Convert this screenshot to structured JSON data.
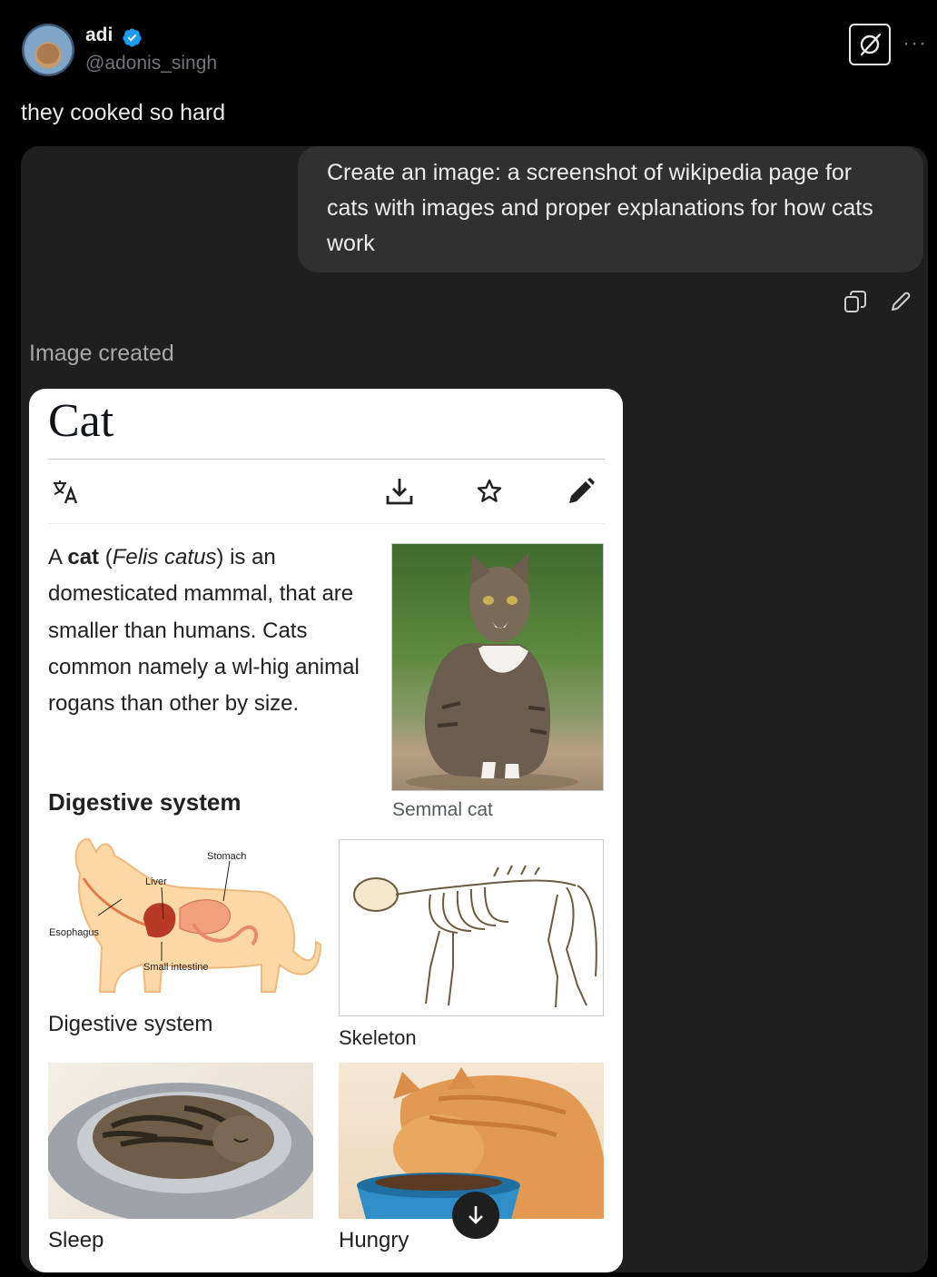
{
  "tweet": {
    "author_name": "adi",
    "author_handle": "@adonis_singh",
    "more_label": "···",
    "text": "they cooked so hard"
  },
  "chat": {
    "user_prompt": "Create an image: a screenshot of wikipedia page for cats with images and proper explanations for how cats work",
    "status": "Image created"
  },
  "wiki": {
    "title": "Cat",
    "intro": {
      "prefix": "A ",
      "bold": "cat",
      "paren_open": " (",
      "italic": "Felis catus",
      "rest": ") is an domesticated mammal, that are smaller than humans. Cats common namely a wl-hig animal rogans than other by size."
    },
    "main_image_caption": "Semmal cat",
    "section_heading": "Digestive system",
    "diagram_labels": {
      "liver": "Liver",
      "stomach": "Stomach",
      "esophagus": "Esophagus",
      "small_intestine": "Small intestine"
    },
    "captions": {
      "digestive": "Digestive system",
      "skeleton": "Skeleton",
      "sleep": "Sleep",
      "hungry": "Hungry"
    }
  },
  "colors": {
    "background": "#000000",
    "card": "#1f1f1f",
    "bubble": "#303030",
    "verified": "#1d9bf0"
  },
  "icons": [
    "verified-badge-icon",
    "grok-icon",
    "copy-icon",
    "edit-icon",
    "translate-icon",
    "download-icon",
    "star-icon",
    "pencil-icon",
    "arrow-down-icon"
  ]
}
